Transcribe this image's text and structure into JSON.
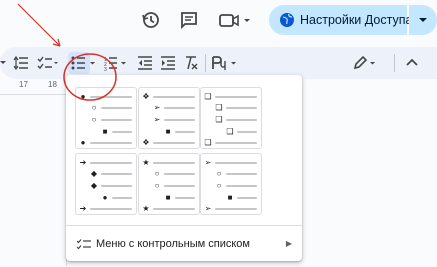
{
  "header": {
    "share_label": "Настройки Доступа",
    "icons": [
      "history-icon",
      "comment-icon",
      "video-call-icon",
      "globe-icon",
      "chevron-down-icon"
    ]
  },
  "toolbar": {
    "icons": [
      "line-spacing-icon",
      "checklist-icon",
      "bulleted-list-icon",
      "numbered-list-icon",
      "decrease-indent-icon",
      "increase-indent-icon",
      "clear-formatting-icon",
      "paint-format-icon",
      "pen-icon",
      "collapse-icon"
    ]
  },
  "ruler": {
    "labels": [
      "17",
      "18"
    ]
  },
  "bullet_menu": {
    "presets": [
      {
        "glyphs": [
          "●",
          "○",
          "○",
          "■",
          "●"
        ]
      },
      {
        "glyphs": [
          "❖",
          "➢",
          "➢",
          "■",
          "❖"
        ]
      },
      {
        "glyphs": [
          "❑",
          "❑",
          "❑",
          "❑",
          "❑"
        ]
      },
      {
        "glyphs": [
          "➔",
          "◆",
          "◆",
          "●",
          "➔"
        ]
      },
      {
        "glyphs": [
          "★",
          "○",
          "○",
          "■",
          "★"
        ]
      },
      {
        "glyphs": [
          "➢",
          "○",
          "○",
          "■",
          "➢"
        ]
      }
    ],
    "checklist_label": "Меню с контрольным списком"
  },
  "colors": {
    "share_bg": "#c2e7ff",
    "toolbar_bg": "#edf2fa",
    "annotation_red": "#d93025"
  }
}
